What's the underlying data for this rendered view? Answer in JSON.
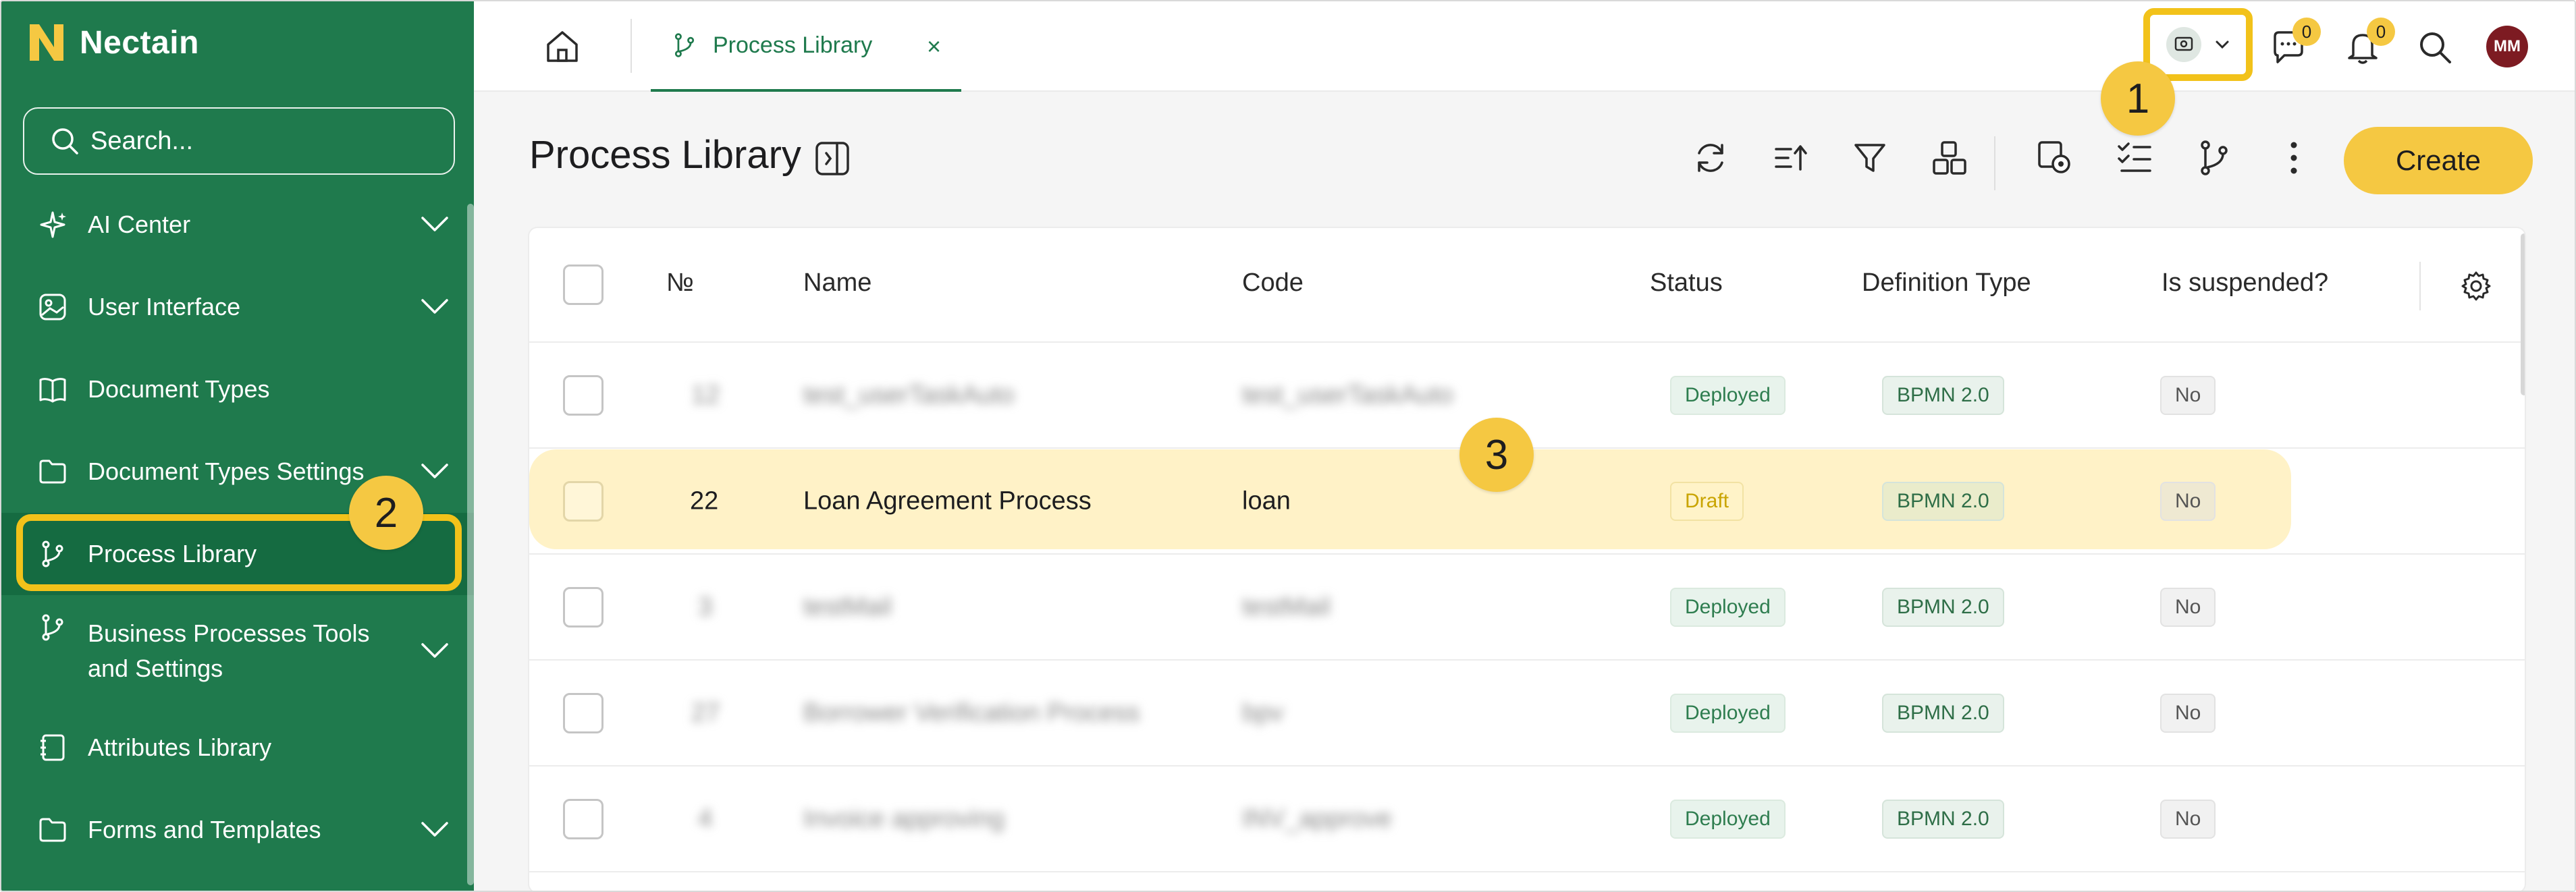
{
  "app": {
    "brand": "Nectain",
    "colors": {
      "sidebar": "#1f7a4d",
      "accent": "#f5c842"
    }
  },
  "sidebar": {
    "search_placeholder": "Search...",
    "items": [
      {
        "label": "AI Center",
        "icon": "sparkle-icon",
        "expandable": true
      },
      {
        "label": "User Interface",
        "icon": "image-icon",
        "expandable": true
      },
      {
        "label": "Document Types",
        "icon": "book-icon",
        "expandable": false
      },
      {
        "label": "Document Types Settings",
        "icon": "folder-icon",
        "expandable": true
      },
      {
        "label": "Process Library",
        "icon": "branch-icon",
        "expandable": false,
        "active": true
      },
      {
        "label": "Business Processes Tools and Settings",
        "icon": "branch-icon",
        "expandable": true
      },
      {
        "label": "Attributes Library",
        "icon": "notebook-icon",
        "expandable": false
      },
      {
        "label": "Forms and Templates",
        "icon": "folder-icon",
        "expandable": true
      }
    ]
  },
  "topbar": {
    "tab_label": "Process Library",
    "tab_close": "×",
    "messages_badge": "0",
    "notifications_badge": "0",
    "avatar_initials": "MM"
  },
  "callouts": {
    "one": "1",
    "two": "2",
    "three": "3"
  },
  "main": {
    "title": "Process Library",
    "create_label": "Create"
  },
  "table": {
    "columns": [
      "№",
      "Name",
      "Code",
      "Status",
      "Definition Type",
      "Is suspended?"
    ],
    "rows": [
      {
        "num": "12",
        "name": "test_userTaskAuto",
        "code": "test_userTaskAuto",
        "status": "Deployed",
        "type": "BPMN 2.0",
        "suspended": "No",
        "blurred": true
      },
      {
        "num": "22",
        "name": "Loan Agreement Process",
        "code": "loan",
        "status": "Draft",
        "type": "BPMN 2.0",
        "suspended": "No",
        "blurred": false
      },
      {
        "num": "3",
        "name": "testMail",
        "code": "testMail",
        "status": "Deployed",
        "type": "BPMN 2.0",
        "suspended": "No",
        "blurred": true
      },
      {
        "num": "27",
        "name": "Borrower Verification Process",
        "code": "bpv",
        "status": "Deployed",
        "type": "BPMN 2.0",
        "suspended": "No",
        "blurred": true
      },
      {
        "num": "4",
        "name": "Invoice approving",
        "code": "INV_approve",
        "status": "Deployed",
        "type": "BPMN 2.0",
        "suspended": "No",
        "blurred": true
      }
    ]
  }
}
